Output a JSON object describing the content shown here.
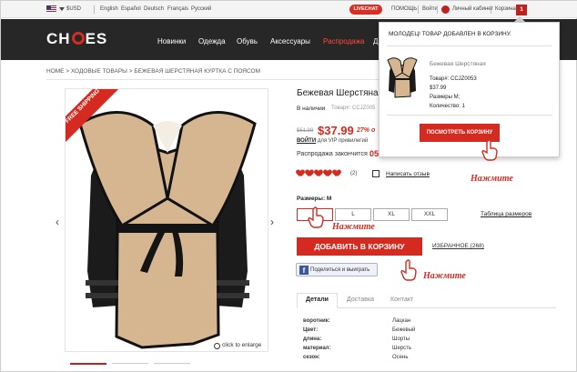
{
  "topbar": {
    "currency": "$USD",
    "languages": [
      "English",
      "Español",
      "Deutsch",
      "Français",
      "Русский"
    ],
    "livechat": "LIVECHAT",
    "help": "ПОМОЩЬ",
    "login": "Войти",
    "personal_cabinet": "Личный кабинет",
    "cart": "Корзина",
    "cart_count": "1"
  },
  "nav": {
    "logo": "CHOIES",
    "items": [
      "Новинки",
      "Одежда",
      "Обувь",
      "Аксессуары",
      "Распродажа",
      "Д"
    ]
  },
  "breadcrumb": "HOME > ХОДОВЫЕ ТОВАРЫ > БЕЖЕВАЯ ШЕРСТЯНАЯ КУРТКА С ПОЯСОМ",
  "product": {
    "ribbon": "FREE SHIPPING",
    "title": "Бежевая Шерстяная",
    "in_stock": "В наличии",
    "sku": "Товар#: CCJZ005",
    "old_price": "$51.99",
    "price": "$37.99",
    "discount": "27% o",
    "vip_link": "ВОЙТИ",
    "vip_text": "для VIP привилегий",
    "sale_ends_label": "Распродажа закончится :",
    "timer": "05",
    "rating": 5,
    "review_count": "(2)",
    "write_review": "Написать отзыв",
    "sizes_label": "Размеры: M",
    "sizes": [
      "M",
      "L",
      "XL",
      "XXL"
    ],
    "size_chart": "Таблица размеров",
    "add_to_cart": "ДОБАВИТЬ В КОРЗИНУ",
    "wishlist": "ИЗБРАННОЕ (268)",
    "facebook": "Поделиться и выиграть",
    "enlarge": "click to enlarge"
  },
  "tabs": [
    "Детали",
    "Доставка",
    "Контакт"
  ],
  "specs": [
    {
      "key": "воротник:",
      "value": "Лацкан"
    },
    {
      "key": "Цвет:",
      "value": "Бежевый"
    },
    {
      "key": "длина:",
      "value": "Шорты"
    },
    {
      "key": "материал:",
      "value": "Шерсть"
    },
    {
      "key": "сезон:",
      "value": "Осень"
    }
  ],
  "popup": {
    "title": "МОЛОДЕЦ! ТОВАР ДОБАВЛЕН В КОРЗИНУ.",
    "product_name": "Бежевая Шерстяная",
    "sku": "Товар#: CCJZ0053",
    "price": "$37.99",
    "size": "Размеры M;",
    "quantity": "Количество: 1",
    "button": "ПОСМОТРЕТЬ КОРЗИНУ"
  },
  "annotations": {
    "click_cart": "Нажмите",
    "click_size": "Нажмите",
    "click_add": "Нажмите"
  },
  "colors": {
    "accent": "#d42a1f",
    "nav_bg": "#272727"
  }
}
